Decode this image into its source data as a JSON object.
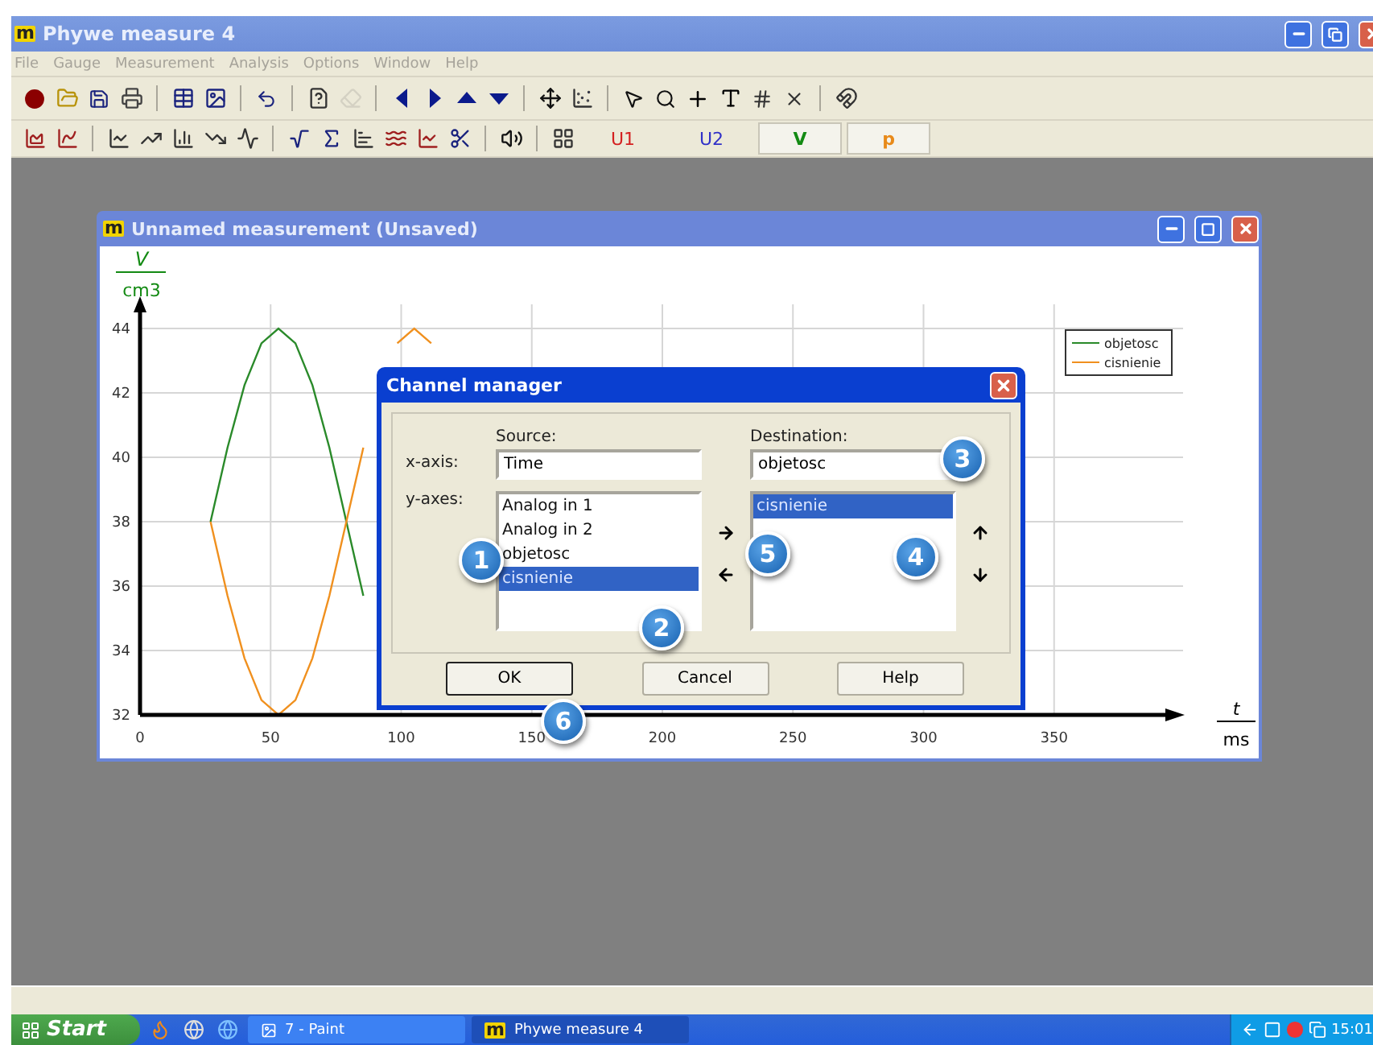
{
  "window": {
    "logo": "m",
    "title": "Phywe measure 4"
  },
  "menu": [
    "File",
    "Gauge",
    "Measurement",
    "Analysis",
    "Options",
    "Window",
    "Help"
  ],
  "toolbar_1": [
    {
      "kind": "record",
      "disabled": false
    },
    {
      "kind": "open",
      "disabled": false
    },
    {
      "kind": "save",
      "disabled": false
    },
    {
      "kind": "print",
      "disabled": false
    },
    {
      "kind": "sep"
    },
    {
      "kind": "table",
      "disabled": false
    },
    {
      "kind": "image",
      "disabled": false
    },
    {
      "kind": "sep"
    },
    {
      "kind": "undo",
      "disabled": false
    },
    {
      "kind": "sep"
    },
    {
      "kind": "help",
      "disabled": false
    },
    {
      "kind": "eraser",
      "disabled": true
    },
    {
      "kind": "sep"
    },
    {
      "kind": "left",
      "disabled": false
    },
    {
      "kind": "right",
      "disabled": false
    },
    {
      "kind": "up",
      "disabled": false
    },
    {
      "kind": "down",
      "disabled": false
    },
    {
      "kind": "sep"
    },
    {
      "kind": "move",
      "disabled": false
    },
    {
      "kind": "scale",
      "disabled": false
    },
    {
      "kind": "sep"
    },
    {
      "kind": "pointer",
      "disabled": false
    },
    {
      "kind": "zoom",
      "disabled": false
    },
    {
      "kind": "cross",
      "disabled": false
    },
    {
      "kind": "text",
      "disabled": false
    },
    {
      "kind": "grid",
      "disabled": false
    },
    {
      "kind": "tangent",
      "disabled": false
    },
    {
      "kind": "sep"
    },
    {
      "kind": "magnet",
      "disabled": false
    }
  ],
  "toolbar_2": [
    {
      "kind": "area"
    },
    {
      "kind": "spline"
    },
    {
      "kind": "sep"
    },
    {
      "kind": "line"
    },
    {
      "kind": "trend"
    },
    {
      "kind": "bar"
    },
    {
      "kind": "decay"
    },
    {
      "kind": "curve"
    },
    {
      "kind": "sep"
    },
    {
      "kind": "root"
    },
    {
      "kind": "function"
    },
    {
      "kind": "peak"
    },
    {
      "kind": "filter"
    },
    {
      "kind": "smooth"
    },
    {
      "kind": "cut"
    },
    {
      "kind": "sep"
    },
    {
      "kind": "sound"
    },
    {
      "kind": "sep"
    },
    {
      "kind": "axes"
    }
  ],
  "channel_buttons": [
    {
      "label": "U1",
      "color": "#d42020",
      "pressed": false
    },
    {
      "label": "U2",
      "color": "#3030c8",
      "pressed": false
    },
    {
      "label": "V",
      "color": "#138a13",
      "pressed": true
    },
    {
      "label": "p",
      "color": "#e88a1a",
      "pressed": true
    }
  ],
  "measurement_window": {
    "logo": "m",
    "title": "Unnamed measurement (Unsaved)",
    "chart_data": {
      "type": "line",
      "ylabel": "V",
      "annotations": [
        {
          "text": "cm3"
        },
        {
          "text": "t"
        },
        {
          "text": "ms"
        }
      ],
      "grid": true,
      "legend": true,
      "xlim": [
        0,
        400
      ],
      "ylim": [
        32,
        44
      ],
      "xticks": [
        0,
        50,
        100,
        150,
        200,
        250,
        300,
        350
      ],
      "yticks": [
        32,
        34,
        36,
        38,
        40,
        42,
        44
      ],
      "x": [
        27,
        33.5,
        40,
        46.5,
        53,
        59.5,
        66,
        72.5,
        79,
        85.5,
        92,
        98.5,
        105,
        111.5
      ],
      "series": [
        {
          "name": "objetosc",
          "color": "#2a8a2a",
          "values": [
            38,
            40.3,
            42.24,
            43.54,
            44,
            43.54,
            42.24,
            40.3,
            38,
            35.7,
            null,
            null,
            null,
            null
          ]
        },
        {
          "name": "cisnienie",
          "color": "#f0901e",
          "values": [
            38,
            35.7,
            33.76,
            32.46,
            32,
            32.46,
            33.76,
            35.7,
            38,
            40.3,
            null,
            43.54,
            44,
            43.54
          ]
        }
      ]
    }
  },
  "dialog": {
    "title": "Channel manager",
    "source_heading": "Source:",
    "destination_heading": "Destination:",
    "x_axis_label": "x-axis:",
    "x_source": "Time",
    "x_destination": "objetosc",
    "y_axes_label": "y-axes:",
    "source_list": [
      {
        "label": "Analog in 1",
        "selected": false
      },
      {
        "label": "Analog in 2",
        "selected": false
      },
      {
        "label": "objetosc",
        "selected": false
      },
      {
        "label": "cisnienie",
        "selected": true
      }
    ],
    "destination_list": [
      {
        "label": "cisnienie",
        "selected": true
      }
    ],
    "buttons": [
      {
        "label": "OK",
        "default": true
      },
      {
        "label": "Cancel",
        "default": false
      },
      {
        "label": "Help",
        "default": false
      }
    ]
  },
  "callouts": [
    "3",
    "1",
    "5",
    "4",
    "2",
    "6"
  ],
  "taskbar": {
    "start": "Start",
    "tasks": [
      {
        "label": "7 - Paint",
        "active": false
      },
      {
        "logo": "m",
        "label": "Phywe measure 4",
        "active": true
      }
    ],
    "clock": "15:01"
  }
}
